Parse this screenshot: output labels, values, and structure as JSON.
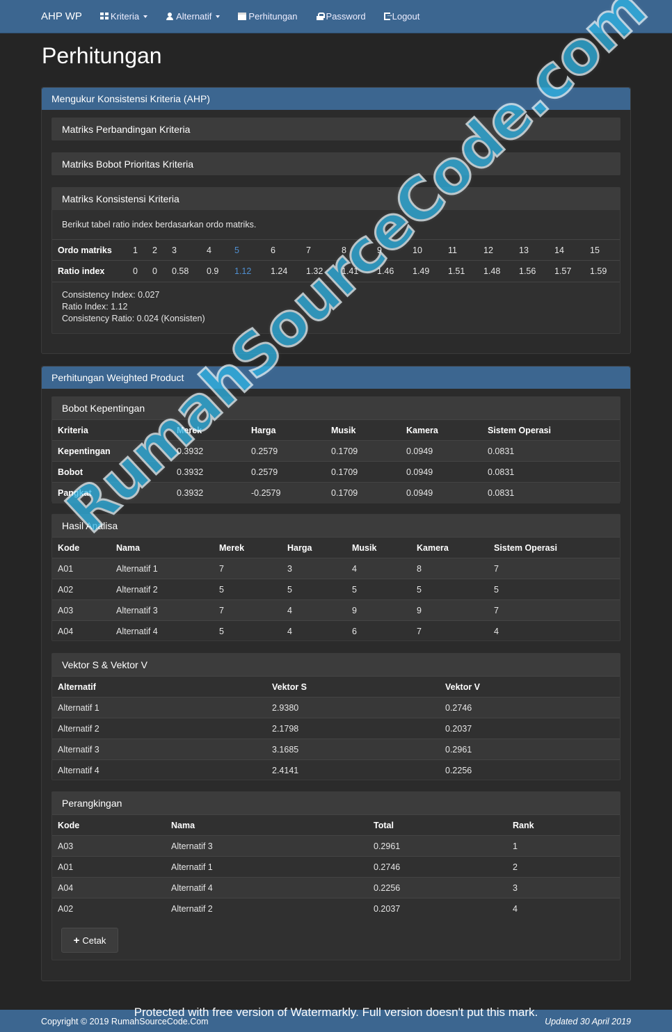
{
  "nav": {
    "brand": "AHP WP",
    "items": [
      {
        "label": "Kriteria",
        "icon": "grid-icon",
        "caret": true
      },
      {
        "label": "Alternatif",
        "icon": "user-icon",
        "caret": true
      },
      {
        "label": "Perhitungan",
        "icon": "calendar-icon",
        "caret": false
      },
      {
        "label": "Password",
        "icon": "lock-icon",
        "caret": false
      },
      {
        "label": "Logout",
        "icon": "logout-icon",
        "caret": false
      }
    ]
  },
  "page_title": "Perhitungan",
  "ahp": {
    "title": "Mengukur Konsistensi Kriteria (AHP)",
    "sections": [
      "Matriks Perbandingan Kriteria",
      "Matriks Bobot Prioritas Kriteria",
      "Matriks Konsistensi Kriteria"
    ],
    "note": "Berikut tabel ratio index berdasarkan ordo matriks.",
    "ordo_label": "Ordo matriks",
    "ratio_label": "Ratio index",
    "ordo": [
      "1",
      "2",
      "3",
      "4",
      "5",
      "6",
      "7",
      "8",
      "9",
      "10",
      "11",
      "12",
      "13",
      "14",
      "15"
    ],
    "ratio": [
      "0",
      "0",
      "0.58",
      "0.9",
      "1.12",
      "1.24",
      "1.32",
      "1.41",
      "1.46",
      "1.49",
      "1.51",
      "1.48",
      "1.56",
      "1.57",
      "1.59"
    ],
    "ci": "Consistency Index: 0.027",
    "ri": "Ratio Index: 1.12",
    "cr": "Consistency Ratio: 0.024 (Konsisten)"
  },
  "wp": {
    "title": "Perhitungan Weighted Product",
    "bobot": {
      "title": "Bobot Kepentingan",
      "headers": [
        "Kriteria",
        "Merek",
        "Harga",
        "Musik",
        "Kamera",
        "Sistem Operasi"
      ],
      "rows": [
        [
          "Kepentingan",
          "0.3932",
          "0.2579",
          "0.1709",
          "0.0949",
          "0.0831"
        ],
        [
          "Bobot",
          "0.3932",
          "0.2579",
          "0.1709",
          "0.0949",
          "0.0831"
        ],
        [
          "Pangkat",
          "0.3932",
          "-0.2579",
          "0.1709",
          "0.0949",
          "0.0831"
        ]
      ]
    },
    "analisa": {
      "title": "Hasil Analisa",
      "headers": [
        "Kode",
        "Nama",
        "Merek",
        "Harga",
        "Musik",
        "Kamera",
        "Sistem Operasi"
      ],
      "rows": [
        [
          "A01",
          "Alternatif 1",
          "7",
          "3",
          "4",
          "8",
          "7"
        ],
        [
          "A02",
          "Alternatif 2",
          "5",
          "5",
          "5",
          "5",
          "5"
        ],
        [
          "A03",
          "Alternatif 3",
          "7",
          "4",
          "9",
          "9",
          "7"
        ],
        [
          "A04",
          "Alternatif 4",
          "5",
          "4",
          "6",
          "7",
          "4"
        ]
      ]
    },
    "vektor": {
      "title": "Vektor S & Vektor V",
      "headers": [
        "Alternatif",
        "Vektor S",
        "Vektor V"
      ],
      "rows": [
        [
          "Alternatif 1",
          "2.9380",
          "0.2746"
        ],
        [
          "Alternatif 2",
          "2.1798",
          "0.2037"
        ],
        [
          "Alternatif 3",
          "3.1685",
          "0.2961"
        ],
        [
          "Alternatif 4",
          "2.4141",
          "0.2256"
        ]
      ]
    },
    "ranking": {
      "title": "Perangkingan",
      "headers": [
        "Kode",
        "Nama",
        "Total",
        "Rank"
      ],
      "rows": [
        [
          "A03",
          "Alternatif 3",
          "0.2961",
          "1"
        ],
        [
          "A01",
          "Alternatif 1",
          "0.2746",
          "2"
        ],
        [
          "A04",
          "Alternatif 4",
          "0.2256",
          "3"
        ],
        [
          "A02",
          "Alternatif 2",
          "0.2037",
          "4"
        ]
      ]
    },
    "print_label": "Cetak"
  },
  "watermark": "RumahSourceCode.com",
  "watermark_notice": "Protected with free version of Watermarkly. Full version doesn't put this mark.",
  "footer": {
    "left": "Copyright © 2019 RumahSourceCode.Com",
    "right": "Updated 30 April 2019"
  },
  "colors": {
    "navbar": "#3c6690",
    "background": "#252525",
    "highlight": "#4f8fd0",
    "watermark": "#2fb5e6"
  }
}
